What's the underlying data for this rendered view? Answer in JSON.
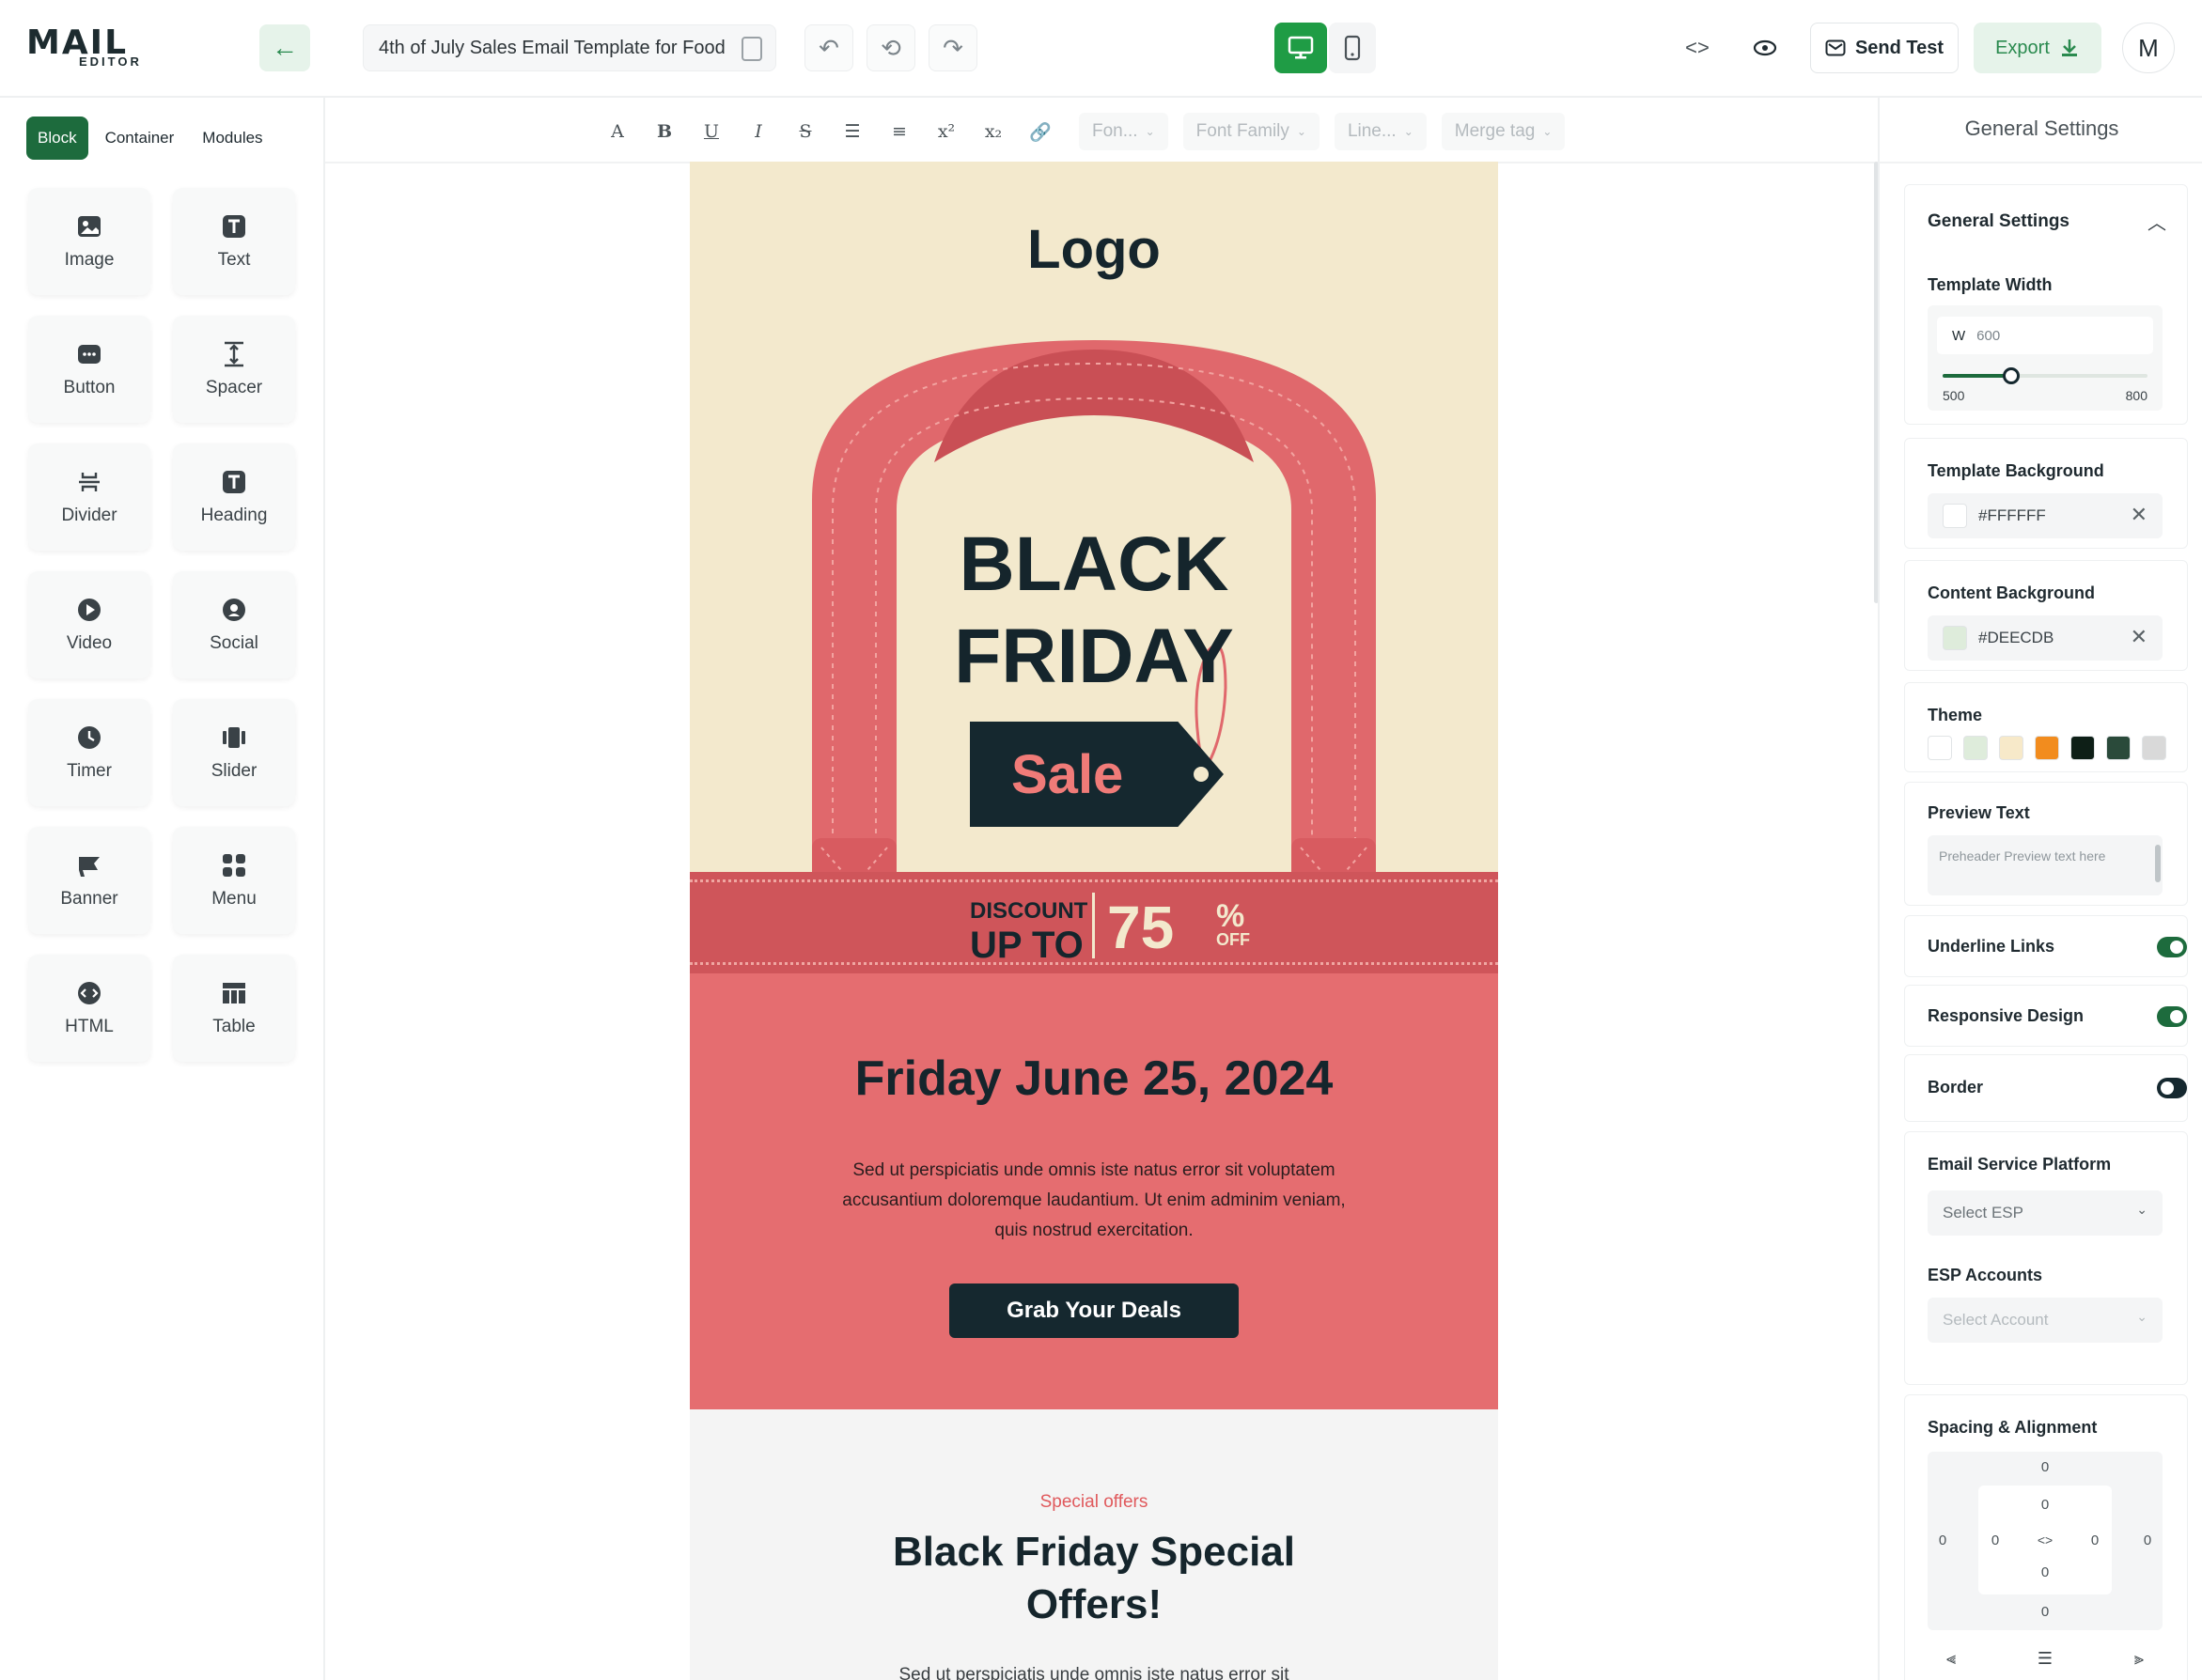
{
  "app": {
    "logo_main": "MAIL",
    "logo_sub": "EDITOR"
  },
  "toolbar": {
    "back_icon": "arrow-left-icon",
    "template_title": "4th of July Sales Email Template for Food",
    "undo_icon": "undo-icon",
    "history_icon": "history-icon",
    "redo_icon": "redo-icon",
    "desktop_icon": "desktop-icon",
    "mobile_icon": "mobile-icon",
    "code_icon": "code-icon",
    "preview_icon": "eye-icon",
    "send_test_label": "Send Test",
    "export_label": "Export",
    "avatar_initial": "M"
  },
  "sidebar": {
    "tabs": [
      {
        "label": "Block",
        "active": true
      },
      {
        "label": "Container",
        "active": false
      },
      {
        "label": "Modules",
        "active": false
      }
    ],
    "blocks": [
      {
        "label": "Image",
        "icon": "image-icon"
      },
      {
        "label": "Text",
        "icon": "text-icon"
      },
      {
        "label": "Button",
        "icon": "button-icon"
      },
      {
        "label": "Spacer",
        "icon": "spacer-icon"
      },
      {
        "label": "Divider",
        "icon": "divider-icon"
      },
      {
        "label": "Heading",
        "icon": "heading-icon"
      },
      {
        "label": "Video",
        "icon": "video-icon"
      },
      {
        "label": "Social",
        "icon": "social-icon"
      },
      {
        "label": "Timer",
        "icon": "timer-icon"
      },
      {
        "label": "Slider",
        "icon": "slider-icon"
      },
      {
        "label": "Banner",
        "icon": "banner-icon"
      },
      {
        "label": "Menu",
        "icon": "menu-icon"
      },
      {
        "label": "HTML",
        "icon": "html-icon"
      },
      {
        "label": "Table",
        "icon": "table-icon"
      }
    ]
  },
  "format_bar": {
    "buttons": [
      {
        "glyph": "A",
        "icon": "text-color-icon"
      },
      {
        "glyph": "B",
        "icon": "bold-icon"
      },
      {
        "glyph": "U",
        "icon": "underline-icon"
      },
      {
        "glyph": "I",
        "icon": "italic-icon"
      },
      {
        "glyph": "S",
        "icon": "strikethrough-icon"
      },
      {
        "glyph": "☰",
        "icon": "bullet-list-icon"
      },
      {
        "glyph": "≡",
        "icon": "numbered-list-icon"
      },
      {
        "glyph": "x²",
        "icon": "superscript-icon"
      },
      {
        "glyph": "x₂",
        "icon": "subscript-icon"
      },
      {
        "glyph": "🔗",
        "icon": "link-icon"
      }
    ],
    "font_size_placeholder": "Fon...",
    "font_family_placeholder": "Font Family",
    "line_height_placeholder": "Line...",
    "merge_tag_placeholder": "Merge tag"
  },
  "email": {
    "logo_text": "Logo",
    "headline_line1": "BLACK",
    "headline_line2": "FRIDAY",
    "sale_tag": "Sale",
    "discount_line1": "DISCOUNT",
    "discount_line2": "UP TO",
    "discount_value": "75",
    "discount_percent": "%",
    "discount_off": "OFF",
    "date": "Friday June 25, 2024",
    "body": "Sed ut perspiciatis unde omnis iste natus error sit voluptatem accusantium doloremque laudantium. Ut enim adminim veniam, quis nostrud exercitation.",
    "cta_label": "Grab Your Deals",
    "offers_small": "Special offers",
    "offers_title": "Black Friday Special Offers!",
    "offers_body": "Sed ut perspiciatis unde omnis iste natus error sit"
  },
  "settings": {
    "panel_title": "General Settings",
    "section_title": "General Settings",
    "template_width_label": "Template Width",
    "width_prefix": "W",
    "width_value": "600",
    "width_min": "500",
    "width_max": "800",
    "width_slider_fraction": 0.333,
    "template_bg_label": "Template Background",
    "template_bg_value": "#FFFFFF",
    "content_bg_label": "Content Background",
    "content_bg_value": "#DEECDB",
    "theme_label": "Theme",
    "theme_colors": [
      "#FFFFFF",
      "#DEECDB",
      "#F7E9C9",
      "#F28C1E",
      "#0E1F17",
      "#2A4A3A",
      "#D9D9D9"
    ],
    "preview_text_label": "Preview Text",
    "preview_text_placeholder": "Preheader Preview text here",
    "underline_links_label": "Underline Links",
    "underline_links_on": true,
    "responsive_label": "Responsive Design",
    "responsive_on": true,
    "border_label": "Border",
    "border_on": false,
    "esp_label": "Email Service Platform",
    "esp_placeholder": "Select ESP",
    "esp_accounts_label": "ESP Accounts",
    "esp_accounts_placeholder": "Select Account",
    "spacing_label": "Spacing & Alignment",
    "spacing_values": {
      "margin_top": "0",
      "padding_top": "0",
      "margin_left": "0",
      "padding_left": "0",
      "padding_right": "0",
      "margin_right": "0",
      "padding_bottom": "0",
      "margin_bottom": "0"
    }
  },
  "colors": {
    "accent": "#1F9C45",
    "dark": "#15282F",
    "pink": "#E56D70",
    "cream": "#F3E9CD"
  }
}
